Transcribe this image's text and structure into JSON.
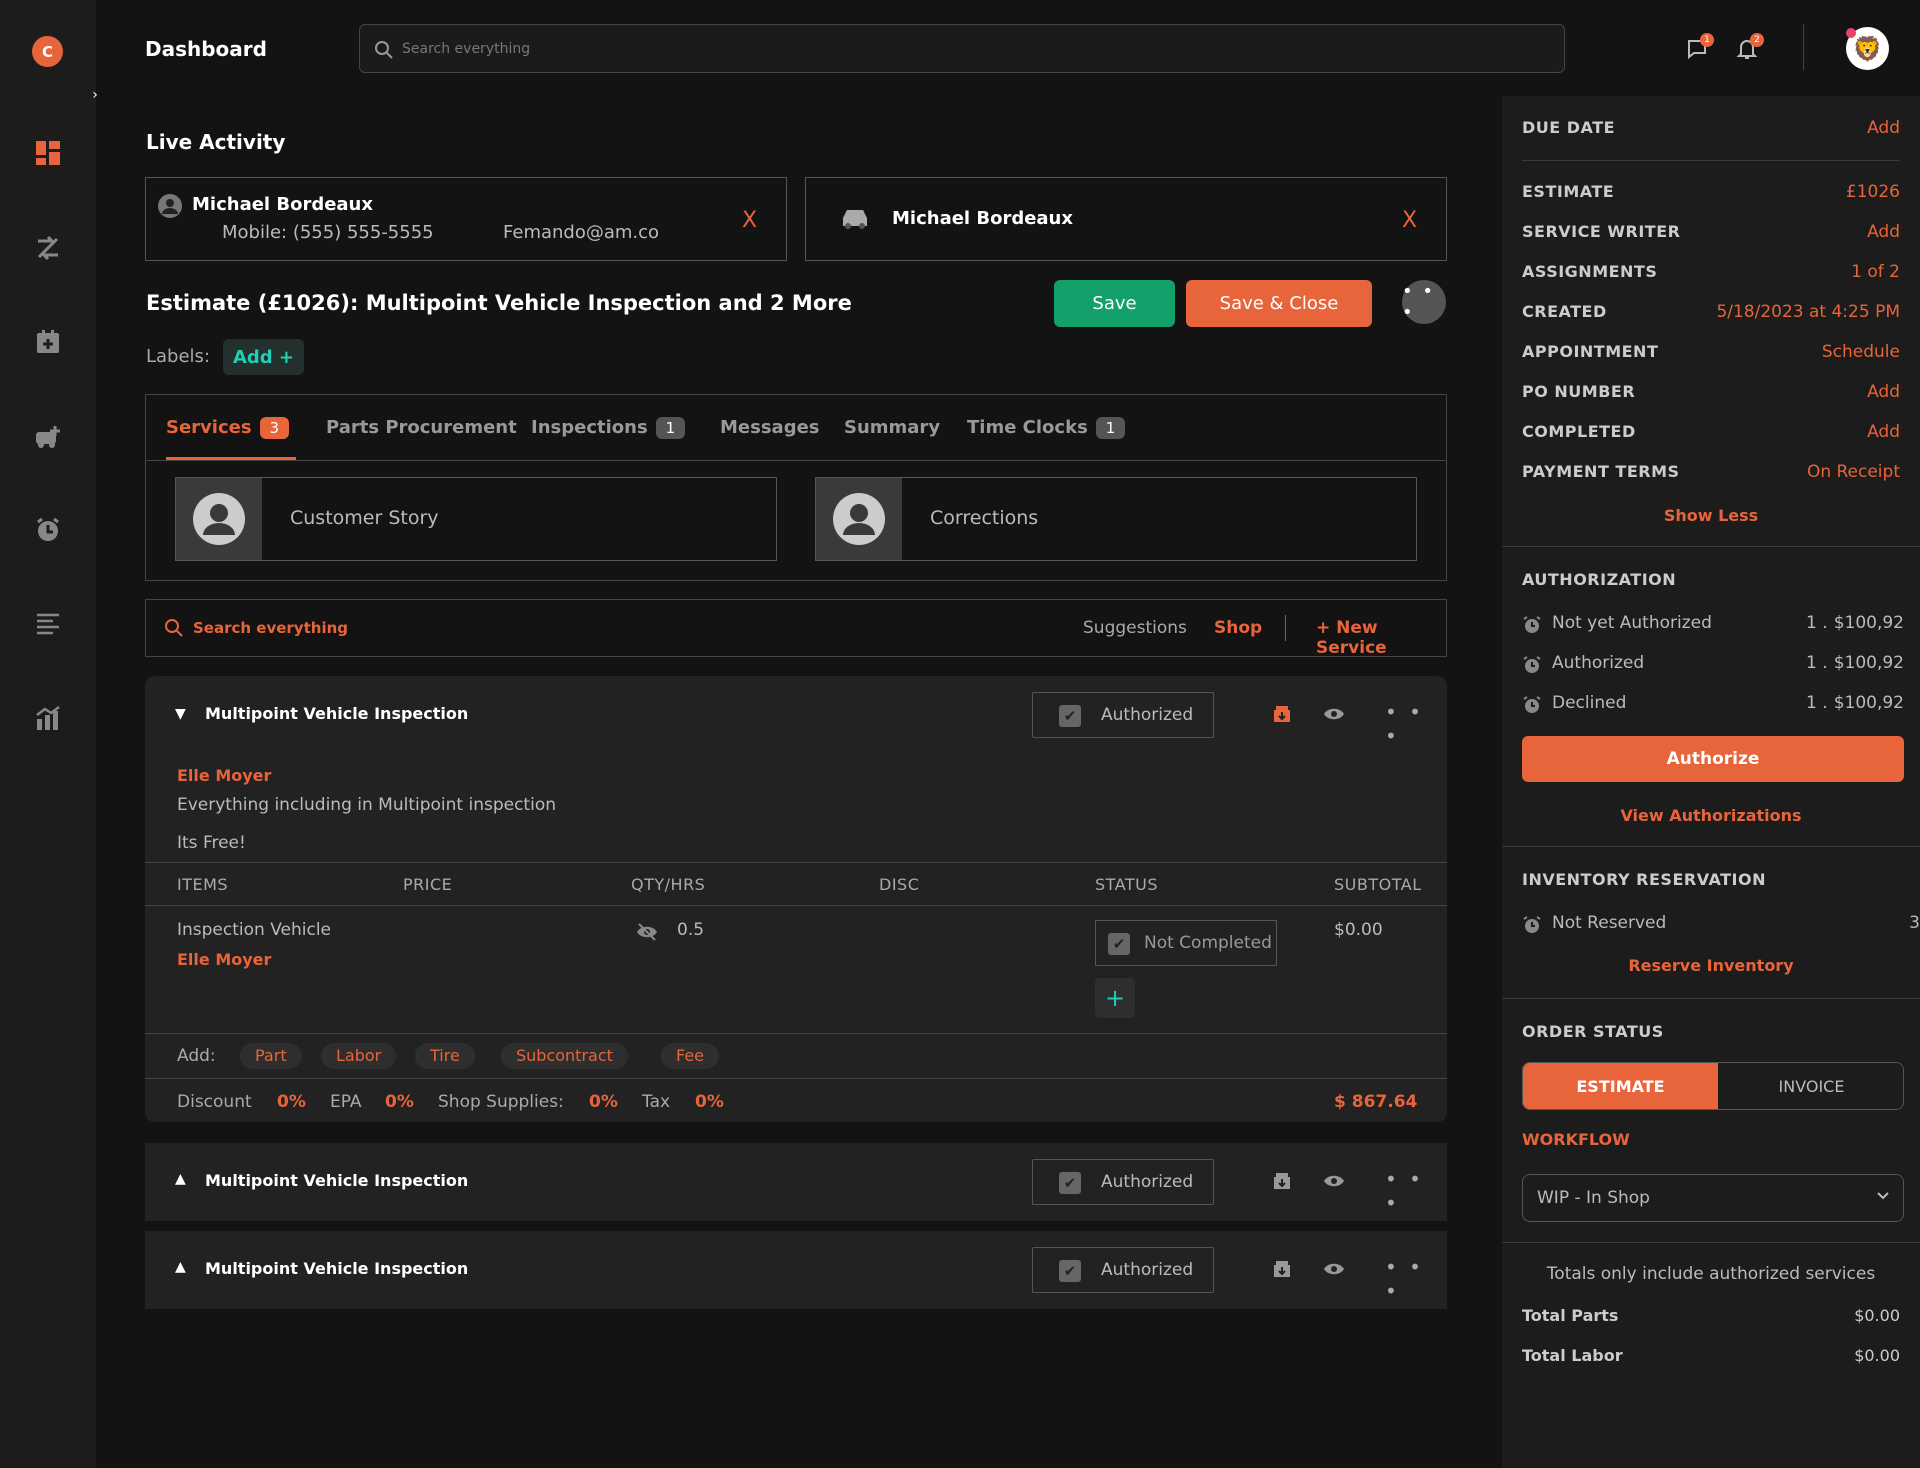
{
  "app": {
    "logo_letter": "C",
    "title": "Dashboard",
    "search_placeholder": "Search everything",
    "accent": "#e8643a",
    "teal": "#1fcfb6"
  },
  "header": {
    "messages_count": "1",
    "notifications_count": "2",
    "avatar_emoji": "🦁"
  },
  "live_activity": {
    "title": "Live Activity",
    "customer": {
      "name": "Michael Bordeaux",
      "mobile": "Mobile: (555) 555-5555",
      "email": "Femando@am.co",
      "close": "X"
    },
    "vehicle": {
      "name": "Michael Bordeaux",
      "close": "X"
    }
  },
  "estimate": {
    "title": "Estimate (£1026): Multipoint Vehicle Inspection and 2 More",
    "save": "Save",
    "save_close": "Save & Close",
    "more": "• • •"
  },
  "labels": {
    "label": "Labels:",
    "add": "Add +"
  },
  "tabs": [
    {
      "label": "Services",
      "count": "3"
    },
    {
      "label": "Parts Procurement",
      "count": ""
    },
    {
      "label": "Inspections",
      "count": "1"
    },
    {
      "label": "Messages",
      "count": ""
    },
    {
      "label": "Summary",
      "count": ""
    },
    {
      "label": "Time Clocks",
      "count": "1"
    }
  ],
  "story": {
    "customer": "Customer Story",
    "corrections": "Corrections"
  },
  "service_bar": {
    "search": "Search everything",
    "suggestions": "Suggestions",
    "shop": "Shop",
    "new_service": "+ New Service"
  },
  "services": [
    {
      "title": "Multipoint Vehicle Inspection",
      "status": "Authorized",
      "more": "• • •",
      "technician": "Elle Moyer",
      "description": "Everything including in Multipoint inspection",
      "note": "Its Free!",
      "columns": [
        "ITEMS",
        "PRICE",
        "QTY/HRS",
        "DISC",
        "STATUS",
        "SUBTOTAL"
      ],
      "item": {
        "name": "Inspection Vehicle",
        "tech": "Elle Moyer",
        "qty": "0.5",
        "status": "Not Completed",
        "subtotal": "$0.00"
      },
      "add_label": "Add:",
      "add_chips": [
        "Part",
        "Labor",
        "Tire",
        "Subcontract",
        "Fee"
      ],
      "totals": {
        "discount_label": "Discount",
        "discount": "0%",
        "epa_label": "EPA",
        "epa": "0%",
        "shop_label": "Shop Supplies:",
        "shop": "0%",
        "tax_label": "Tax",
        "tax": "0%",
        "total": "$ 867.64"
      }
    },
    {
      "title": "Multipoint Vehicle Inspection",
      "status": "Authorized",
      "more": "• • •"
    },
    {
      "title": "Multipoint Vehicle Inspection",
      "status": "Authorized",
      "more": "• • •"
    }
  ],
  "right": {
    "details": [
      {
        "key": "DUE DATE",
        "value": "Add"
      },
      {
        "key": "ESTIMATE",
        "value": "£1026"
      },
      {
        "key": "SERVICE WRITER",
        "value": "Add"
      },
      {
        "key": "ASSIGNMENTS",
        "value": "1 of 2"
      },
      {
        "key": "CREATED",
        "value": "5/18/2023 at 4:25 PM"
      },
      {
        "key": "APPOINTMENT",
        "value": "Schedule"
      },
      {
        "key": "PO NUMBER",
        "value": "Add"
      },
      {
        "key": "COMPLETED",
        "value": "Add"
      },
      {
        "key": "PAYMENT TERMS",
        "value": "On Receipt"
      }
    ],
    "show_less": "Show Less",
    "authorization": {
      "title": "AUTHORIZATION",
      "rows": [
        {
          "label": "Not yet Authorized",
          "count": "1 .",
          "amount": "$100,92"
        },
        {
          "label": "Authorized",
          "count": "1 .",
          "amount": "$100,92"
        },
        {
          "label": "Declined",
          "count": "1 .",
          "amount": "$100,92"
        }
      ],
      "button": "Authorize",
      "view": "View Authorizations"
    },
    "inventory": {
      "title": "INVENTORY RESERVATION",
      "label": "Not Reserved",
      "count": "3",
      "link": "Reserve Inventory"
    },
    "order_status": {
      "title": "ORDER STATUS",
      "estimate": "ESTIMATE",
      "invoice": "INVOICE",
      "workflow_label": "WORKFLOW",
      "workflow_value": "WIP - In Shop"
    },
    "totals": {
      "note": "Totals only include authorized services",
      "parts_label": "Total Parts",
      "parts": "$0.00",
      "labor_label": "Total Labor",
      "labor": "$0.00"
    }
  }
}
